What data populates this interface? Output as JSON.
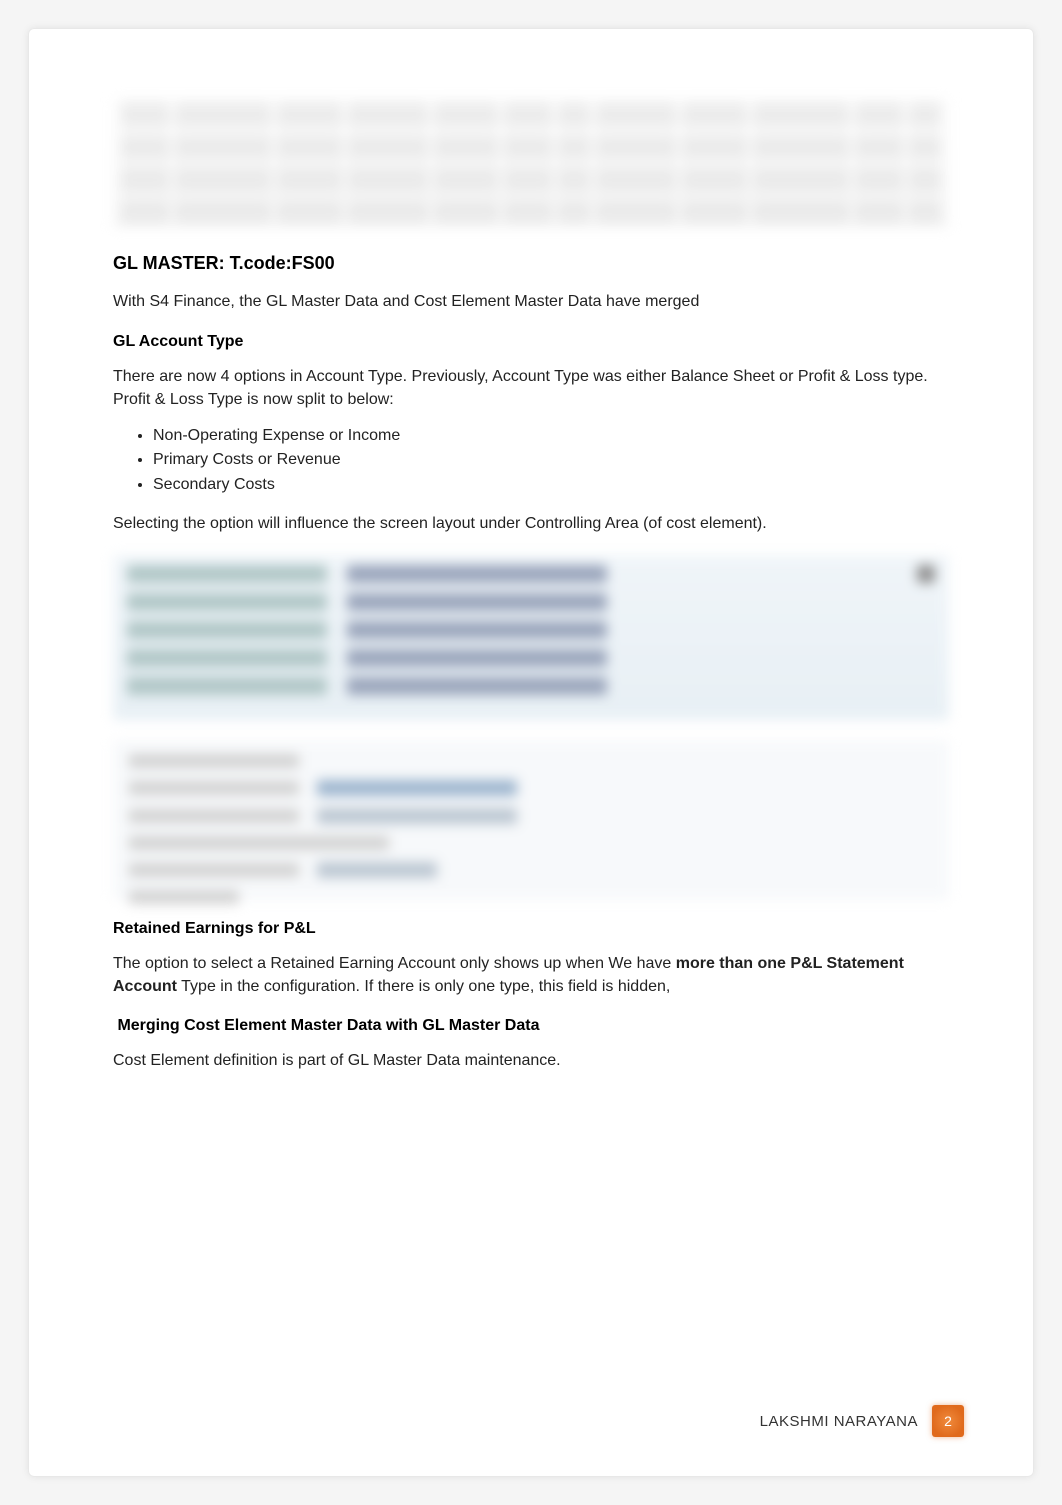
{
  "headings": {
    "gl_master": "GL MASTER: T.code:FS00",
    "gl_account_type": "GL Account Type",
    "retained_earnings": "Retained Earnings for P&L",
    "merging": "Merging Cost Element Master Data with GL Master Data"
  },
  "paragraphs": {
    "gl_master_intro": "With S4 Finance, the GL Master Data and Cost Element Master Data have merged",
    "account_type_intro": "There are now 4 options in Account Type. Previously, Account Type was either Balance Sheet or Profit & Loss type. Profit & Loss Type is now split to below:",
    "selecting_option": "Selecting the option will influence the screen layout under Controlling Area (of cost element).",
    "retained_intro_pre": "The option to select a Retained Earning Account only shows up when We have ",
    "retained_intro_strong": "more than one P&L Statement Account",
    "retained_intro_post": " Type in the configuration. If there is only one type, this field is hidden,",
    "merging_body": "Cost Element definition is part of GL Master Data maintenance."
  },
  "bullets": {
    "account_types": [
      "Non-Operating Expense or Income",
      "Primary Costs or Revenue",
      "Secondary Costs"
    ]
  },
  "footer": {
    "author": "LAKSHMI NARAYANA",
    "page_number": "2"
  }
}
